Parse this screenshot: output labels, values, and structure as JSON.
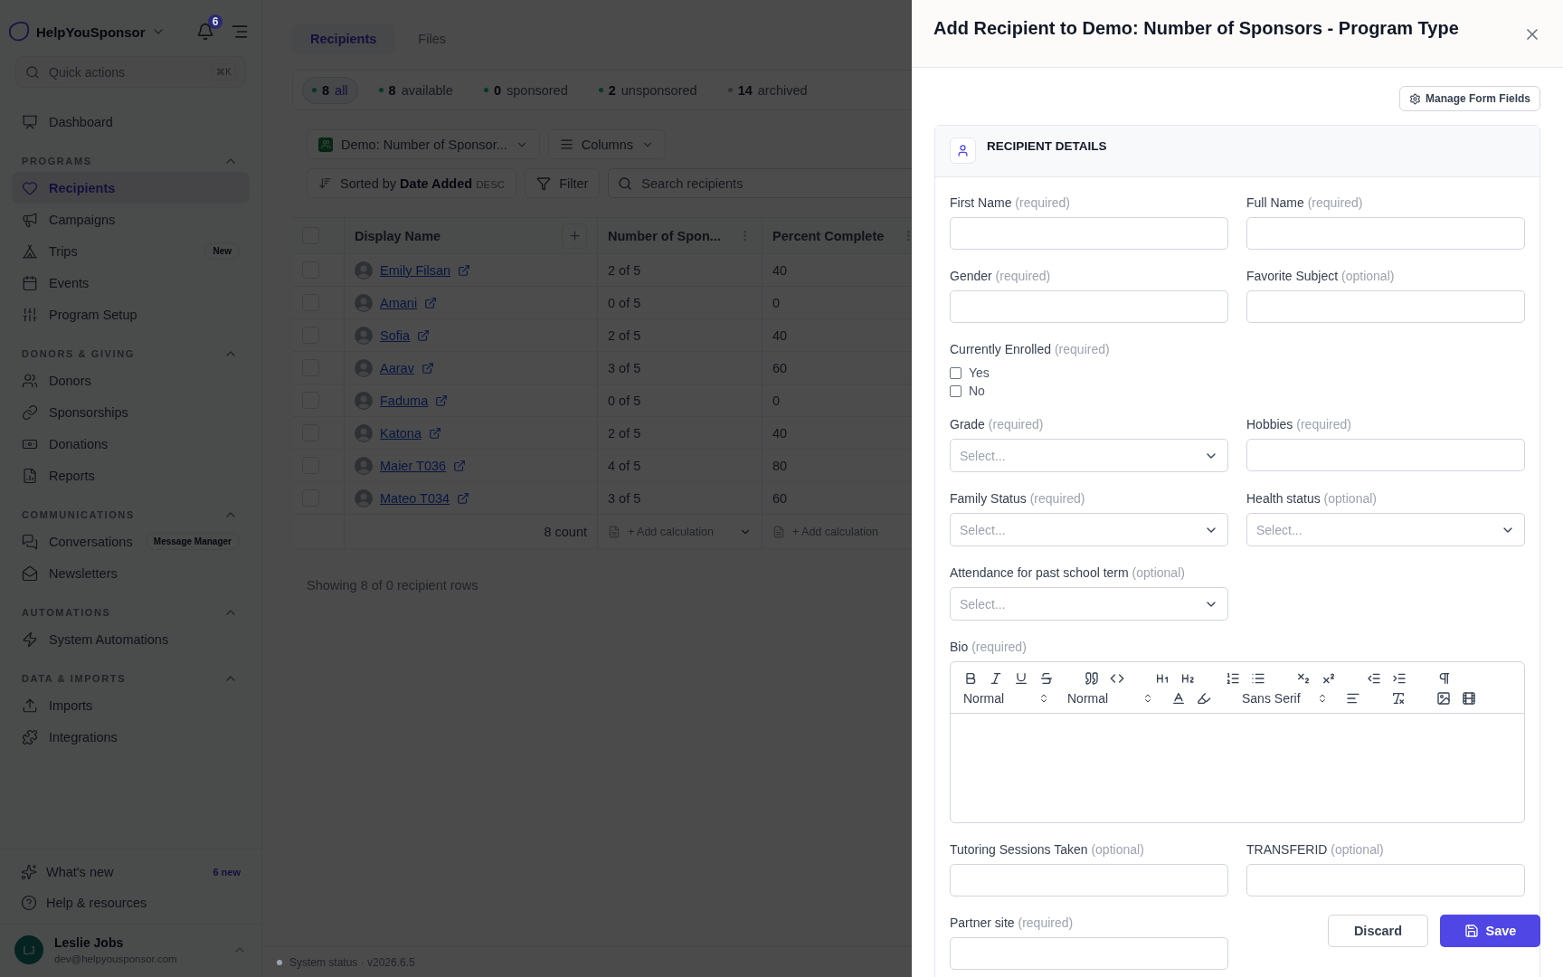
{
  "sidebar": {
    "brand": "HelpYouSponsor",
    "notification_count": "6",
    "search": {
      "placeholder": "Quick actions",
      "shortcut": "⌘K"
    },
    "top_items": [
      {
        "label": "Dashboard",
        "selected": false
      }
    ],
    "sections": [
      {
        "title": "PROGRAMS",
        "expanded": true,
        "items": [
          {
            "label": "Recipients",
            "selected": true
          },
          {
            "label": "Campaigns",
            "selected": false
          },
          {
            "label": "Trips",
            "selected": false,
            "badge": "New"
          },
          {
            "label": "Events",
            "selected": false
          },
          {
            "label": "Program Setup",
            "selected": false
          }
        ]
      },
      {
        "title": "DONORS & GIVING",
        "expanded": true,
        "items": [
          {
            "label": "Donors",
            "selected": false
          },
          {
            "label": "Sponsorships",
            "selected": false
          },
          {
            "label": "Donations",
            "selected": false
          },
          {
            "label": "Reports",
            "selected": false
          }
        ]
      },
      {
        "title": "COMMUNICATIONS",
        "expanded": true,
        "items": [
          {
            "label": "Conversations",
            "selected": false,
            "badge": "Message Manager"
          },
          {
            "label": "Newsletters",
            "selected": false
          }
        ]
      },
      {
        "title": "AUTOMATIONS",
        "expanded": true,
        "items": [
          {
            "label": "System Automations",
            "selected": false
          }
        ]
      },
      {
        "title": "DATA & IMPORTS",
        "expanded": true,
        "items": [
          {
            "label": "Imports",
            "selected": false
          },
          {
            "label": "Integrations",
            "selected": false
          }
        ]
      }
    ],
    "footer_items": [
      {
        "label": "What's new",
        "badge": "6 new"
      },
      {
        "label": "Help & resources"
      }
    ],
    "user": {
      "initials": "LJ",
      "name": "Leslie Jobs",
      "email": "dev@helpyousponsor.com"
    }
  },
  "main": {
    "tabs": [
      {
        "label": "Recipients",
        "selected": true
      },
      {
        "label": "Files",
        "selected": false
      }
    ],
    "status_filters": [
      {
        "count": "8",
        "label": "all",
        "selected": true,
        "color": "#053727"
      },
      {
        "count": "8",
        "label": "available",
        "selected": false,
        "color": "#053727"
      },
      {
        "count": "0",
        "label": "sponsored",
        "selected": false,
        "color": "#053727"
      },
      {
        "count": "2",
        "label": "unsponsored",
        "selected": false,
        "color": "#053727"
      },
      {
        "count": "14",
        "label": "archived",
        "selected": false,
        "color": "#2f3135"
      }
    ],
    "program_select": "Demo: Number of Sponsor...",
    "columns_button": "Columns",
    "sort": {
      "prefix": "Sorted by",
      "field": "Date Added",
      "direction": "DESC"
    },
    "filter_button": "Filter",
    "search": {
      "placeholder": "Search recipients"
    },
    "table": {
      "columns": [
        "Display Name",
        "Number of Spon...",
        "Percent Complete"
      ],
      "all_selected": false,
      "rows": [
        {
          "name": "Emily Filsan",
          "sponsors": "2 of 5",
          "percent": "40",
          "selected": false
        },
        {
          "name": "Amani",
          "sponsors": "0 of 5",
          "percent": "0",
          "selected": false
        },
        {
          "name": "Sofia",
          "sponsors": "2 of 5",
          "percent": "40",
          "selected": false
        },
        {
          "name": "Aarav",
          "sponsors": "3 of 5",
          "percent": "60",
          "selected": false
        },
        {
          "name": "Faduma",
          "sponsors": "0 of 5",
          "percent": "0",
          "selected": false
        },
        {
          "name": "Katona",
          "sponsors": "2 of 5",
          "percent": "40",
          "selected": false
        },
        {
          "name": "Maier T036",
          "sponsors": "4 of 5",
          "percent": "80",
          "selected": false
        },
        {
          "name": "Mateo T034",
          "sponsors": "3 of 5",
          "percent": "60",
          "selected": false
        }
      ],
      "footer": {
        "count": "8 count",
        "calculations": [
          "+ Add calculation",
          "+ Add calculation"
        ]
      }
    },
    "summary": "Showing 8 of 0 recipient rows",
    "status_bar": "System status · v2026.6.5"
  },
  "panel": {
    "title": "Add Recipient to Demo: Number of Sponsors - Program Type",
    "manage_button": "Manage Form Fields",
    "section_title": "RECIPIENT DETAILS",
    "rows": [
      [
        {
          "kind": "text",
          "label": "First Name",
          "hint": "(required)"
        },
        {
          "kind": "text",
          "label": "Full Name",
          "hint": "(required)"
        }
      ],
      [
        {
          "kind": "text",
          "label": "Gender",
          "hint": "(required)"
        },
        {
          "kind": "text",
          "label": "Favorite Subject",
          "hint": "(optional)"
        }
      ],
      [
        {
          "kind": "checkboxes",
          "label": "Currently Enrolled",
          "hint": "(required)",
          "options": [
            {
              "label": "Yes",
              "checked": false
            },
            {
              "label": "No",
              "checked": false
            }
          ]
        }
      ],
      [
        {
          "kind": "select",
          "label": "Grade",
          "hint": "(required)",
          "placeholder": "Select..."
        },
        {
          "kind": "text",
          "label": "Hobbies",
          "hint": "(required)"
        }
      ],
      [
        {
          "kind": "select",
          "label": "Family Status",
          "hint": "(required)",
          "placeholder": "Select..."
        },
        {
          "kind": "select",
          "label": "Health status",
          "hint": "(optional)",
          "placeholder": "Select..."
        }
      ],
      [
        {
          "kind": "select",
          "label": "Attendance for past school term",
          "hint": "(optional)",
          "placeholder": "Select..."
        }
      ],
      [
        {
          "kind": "richtext",
          "label": "Bio",
          "hint": "(required)",
          "toolbar_selects": [
            "Normal",
            "Normal",
            "Sans Serif"
          ]
        }
      ],
      [
        {
          "kind": "text",
          "label": "Tutoring Sessions Taken",
          "hint": "(optional)"
        },
        {
          "kind": "text",
          "label": "TRANSFERID",
          "hint": "(optional)"
        }
      ],
      [
        {
          "kind": "text",
          "label": "Partner site",
          "hint": "(required)"
        }
      ]
    ],
    "buttons": {
      "discard": "Discard",
      "save": "Save"
    }
  }
}
